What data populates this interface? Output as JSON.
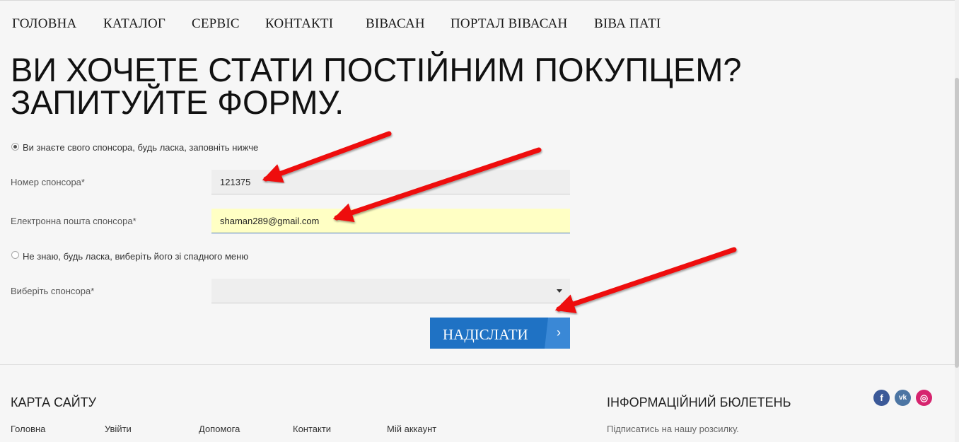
{
  "nav": {
    "items": [
      "ГОЛОВНА",
      "КАТАЛОГ",
      "СЕРВІС",
      "КОНТАКТІ",
      "ВІВАСАН",
      "ПОРТАЛ ВІВАСАН",
      "ВІВА ПАТІ"
    ]
  },
  "page": {
    "title_line1": "ВИ ХОЧЕТЕ СТАТИ ПОСТІЙНИМ ПОКУПЦЕМ?",
    "title_line2": "ЗАПИТУЙТЕ ФОРМУ."
  },
  "form": {
    "option_known": "Ви знаєте свого спонсора, будь ласка, заповніть нижче",
    "sponsor_number_label": "Номер спонсора*",
    "sponsor_number_value": "121375",
    "sponsor_email_label": "Електронна пошта спонсора*",
    "sponsor_email_value": "shaman289@gmail.com",
    "option_unknown": "Не знаю, будь ласка, виберіть його зі спадного меню",
    "select_sponsor_label": "Виберіть спонсора*",
    "select_sponsor_value": "",
    "submit_label": "НАДІСЛАТИ",
    "submit_chevron": "›"
  },
  "footer": {
    "sitemap_heading": "КАРТА САЙТУ",
    "links": [
      "Головна",
      "Увійти",
      "Допомога",
      "Контакти",
      "Мій аккаунт"
    ],
    "newsletter_heading": "ІНФОРМАЦІЙНИЙ БЮЛЕТЕНЬ",
    "newsletter_text": "Підписатись на нашу розсилку.",
    "social": [
      {
        "icon": "facebook-icon",
        "glyph": "f",
        "color": "#3b5998"
      },
      {
        "icon": "vk-icon",
        "glyph": "vk",
        "color": "#4c75a3"
      },
      {
        "icon": "instagram-icon",
        "glyph": "◎",
        "color": "#d6246e"
      }
    ]
  },
  "colors": {
    "accent": "#1f72c4",
    "highlight": "#ffffc4",
    "annotation_arrow": "#ee1111"
  }
}
